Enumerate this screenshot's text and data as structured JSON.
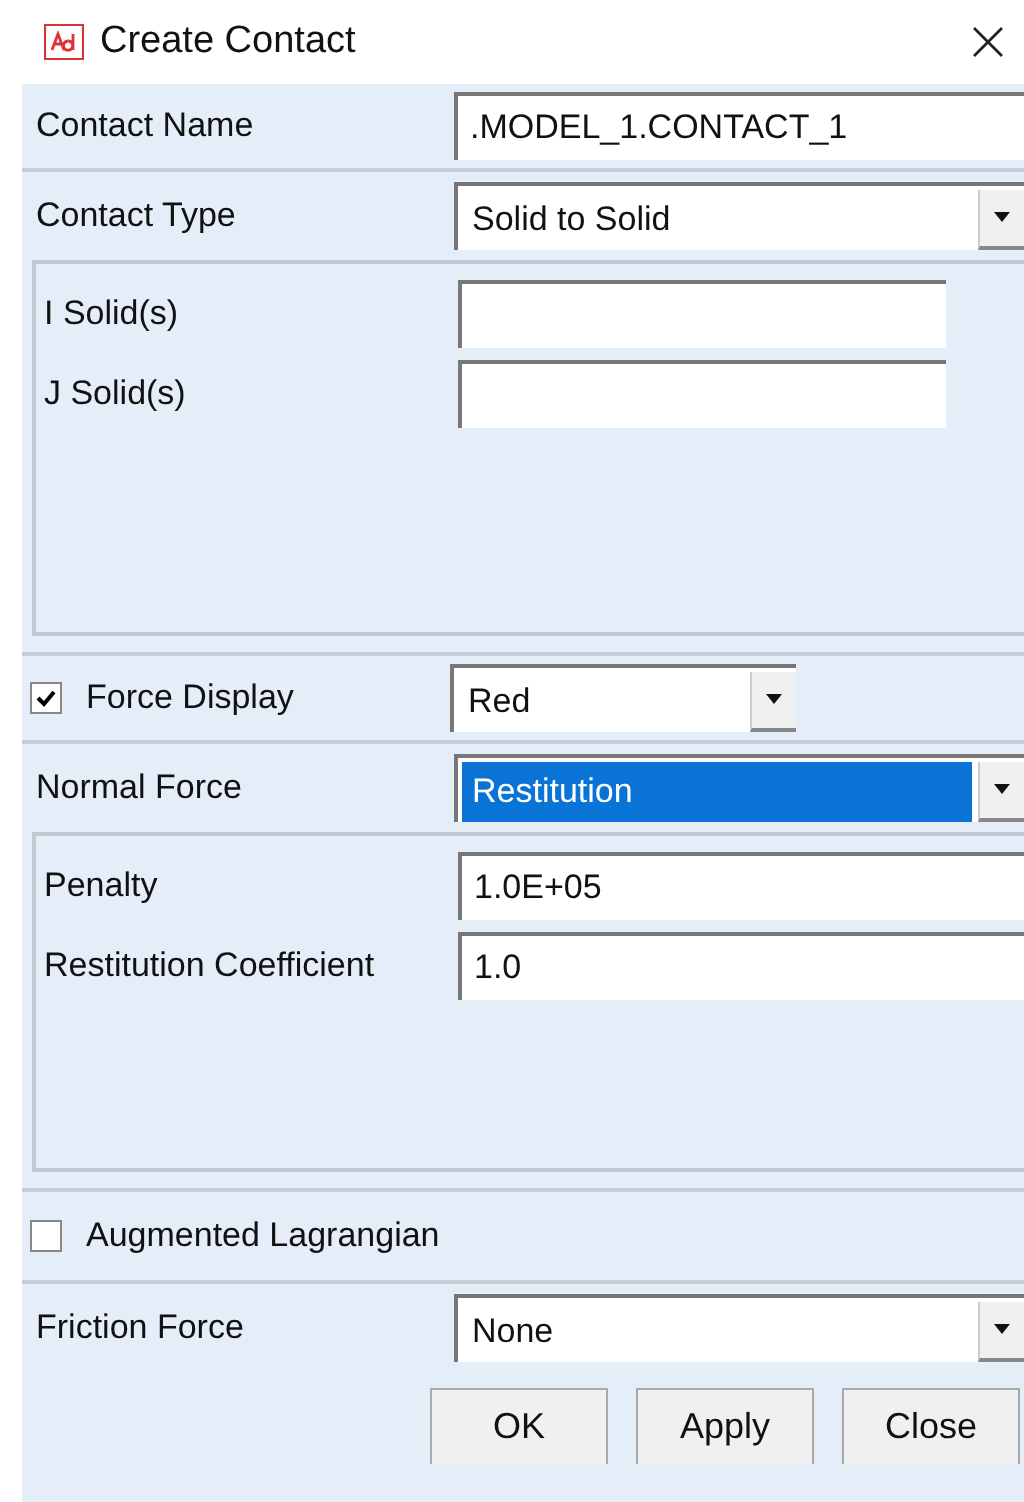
{
  "window": {
    "title": "Create Contact"
  },
  "rows": [
    {
      "kind": "text",
      "label": "Contact Name",
      "value": ".MODEL_1.CONTACT_1"
    },
    {
      "kind": "dropdown",
      "label": "Contact Type",
      "value": "Solid to Solid",
      "selected": false
    },
    {
      "kind": "group",
      "fields": [
        {
          "label": "I Solid(s)",
          "short": true
        },
        {
          "label": "J Solid(s)",
          "short": true
        }
      ]
    },
    {
      "kind": "check-dropdown",
      "label": "Force Display",
      "checked": true,
      "value": "Red"
    },
    {
      "kind": "dropdown",
      "label": "Normal Force",
      "value": "Restitution",
      "selected": true
    },
    {
      "kind": "group",
      "fields": [
        {
          "label": "Penalty",
          "value": "1.0E+05",
          "short": false
        },
        {
          "label": "Restitution Coefficient",
          "value": "1.0",
          "short": false
        }
      ]
    },
    {
      "kind": "checkbox",
      "label": "Augmented Lagrangian",
      "checked": false
    },
    {
      "kind": "dropdown",
      "label": "Friction Force",
      "value": "None",
      "selected": false
    }
  ],
  "buttons": [
    "OK",
    "Apply",
    "Close"
  ]
}
